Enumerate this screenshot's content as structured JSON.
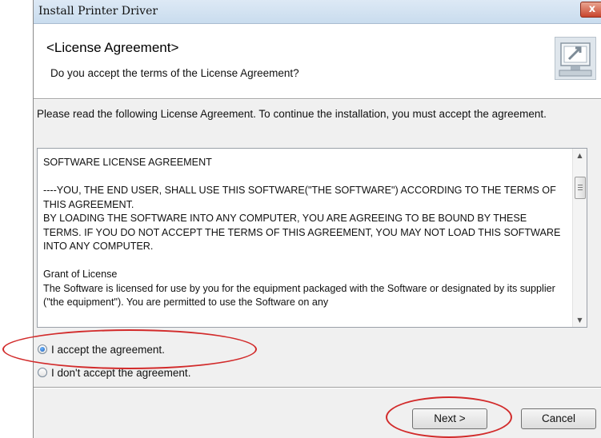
{
  "window": {
    "title": "Install Printer Driver",
    "close_label": "x"
  },
  "header": {
    "title": "<License Agreement>",
    "subtitle": "Do you accept the terms of the License Agreement?",
    "icon": "installer-monitor-icon"
  },
  "instruction": "Please read the following License Agreement. To continue the installation, you must accept the agreement.",
  "license": {
    "paragraphs": [
      "SOFTWARE LICENSE AGREEMENT",
      "----YOU, THE END USER, SHALL USE THIS SOFTWARE(\"THE SOFTWARE\") ACCORDING TO THE TERMS OF THIS AGREEMENT.\nBY LOADING THE SOFTWARE INTO ANY COMPUTER, YOU ARE AGREEING TO BE BOUND BY THESE TERMS. IF YOU DO NOT ACCEPT THE TERMS OF THIS AGREEMENT, YOU MAY NOT LOAD THIS SOFTWARE INTO ANY COMPUTER.",
      "Grant of License\nThe Software is licensed for use by you for the equipment packaged with the Software or designated by its supplier (\"the equipment\"). You are permitted to use the Software on any"
    ]
  },
  "options": {
    "accept": {
      "label": "I accept the agreement.",
      "checked": true
    },
    "decline": {
      "label": "I don't accept the agreement.",
      "checked": false
    }
  },
  "buttons": {
    "next": "Next >",
    "cancel": "Cancel"
  },
  "colors": {
    "annotation": "#d22b2b",
    "window_bg": "#f0f0f0"
  }
}
